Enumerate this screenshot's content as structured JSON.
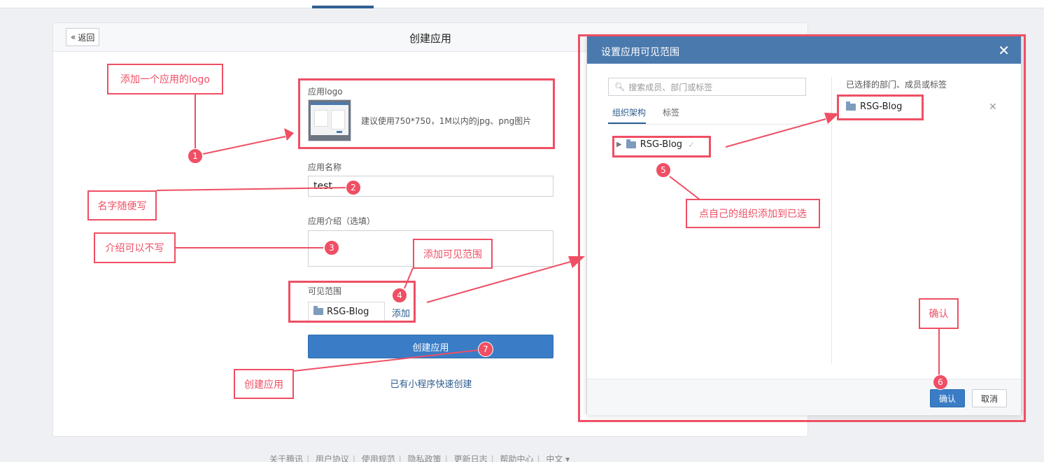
{
  "page": {
    "back_label": "返回",
    "title": "创建应用"
  },
  "form": {
    "logo_label": "应用logo",
    "logo_hint": "建议使用750*750，1M以内的jpg、png图片",
    "name_label": "应用名称",
    "name_value": "test",
    "intro_label": "应用介绍（选填）",
    "intro_value": "",
    "scope_label": "可见范围",
    "scope_chip": "RSG-Blog",
    "add_link": "添加",
    "create_button": "创建应用",
    "mini_program_link": "已有小程序快速创建"
  },
  "footer": {
    "links": [
      "关于腾讯",
      "用户协议",
      "使用规范",
      "隐私政策",
      "更新日志",
      "帮助中心",
      "中文 ▾"
    ]
  },
  "dialog": {
    "title": "设置应用可见范围",
    "search_placeholder": "搜索成员、部门或标签",
    "tabs": [
      "组织架构",
      "标签"
    ],
    "tree_item": "RSG-Blog",
    "selected_title": "已选择的部门、成员或标签",
    "selected_item": "RSG-Blog",
    "confirm_button": "确认",
    "cancel_button": "取消"
  },
  "annotations": {
    "notes": {
      "logo": "添加一个应用的logo",
      "name": "名字随便写",
      "intro": "介绍可以不写",
      "add_scope": "添加可见范围",
      "click_org": "点自己的组织添加到已选",
      "confirm": "确认",
      "create": "创建应用"
    },
    "badges": [
      "1",
      "2",
      "3",
      "4",
      "5",
      "6",
      "7"
    ]
  },
  "colors": {
    "accent_blue": "#3a7dc6",
    "dialog_header": "#4a79ad",
    "annotation_red": "#ef4f64"
  }
}
